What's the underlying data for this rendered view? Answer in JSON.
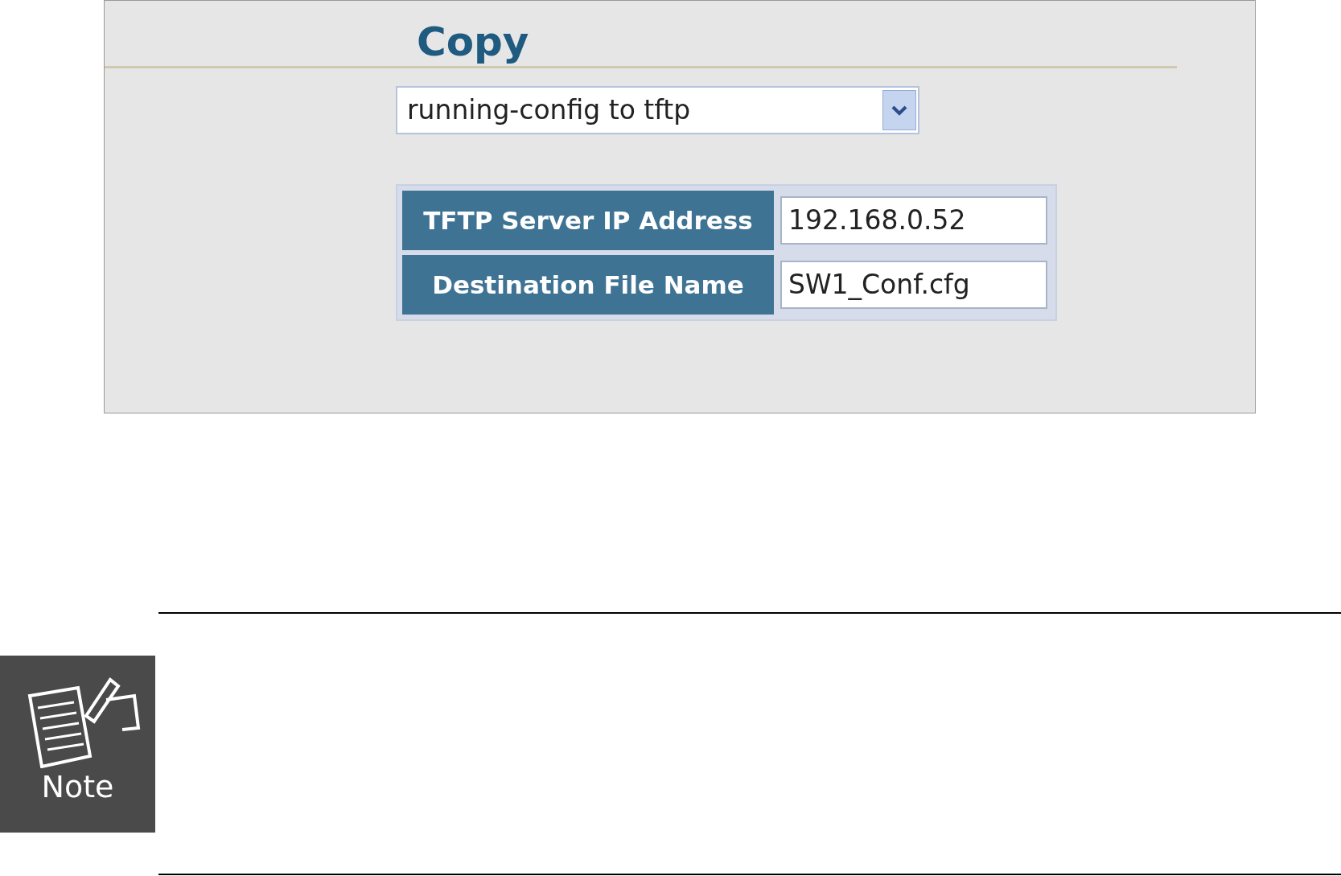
{
  "panel": {
    "title": "Copy",
    "select": {
      "value": "running-config to tftp"
    },
    "fields": [
      {
        "label": "TFTP Server IP Address",
        "value": "192.168.0.52"
      },
      {
        "label": "Destination File Name",
        "value": "SW1_Conf.cfg"
      }
    ]
  },
  "note": {
    "label": "Note"
  }
}
